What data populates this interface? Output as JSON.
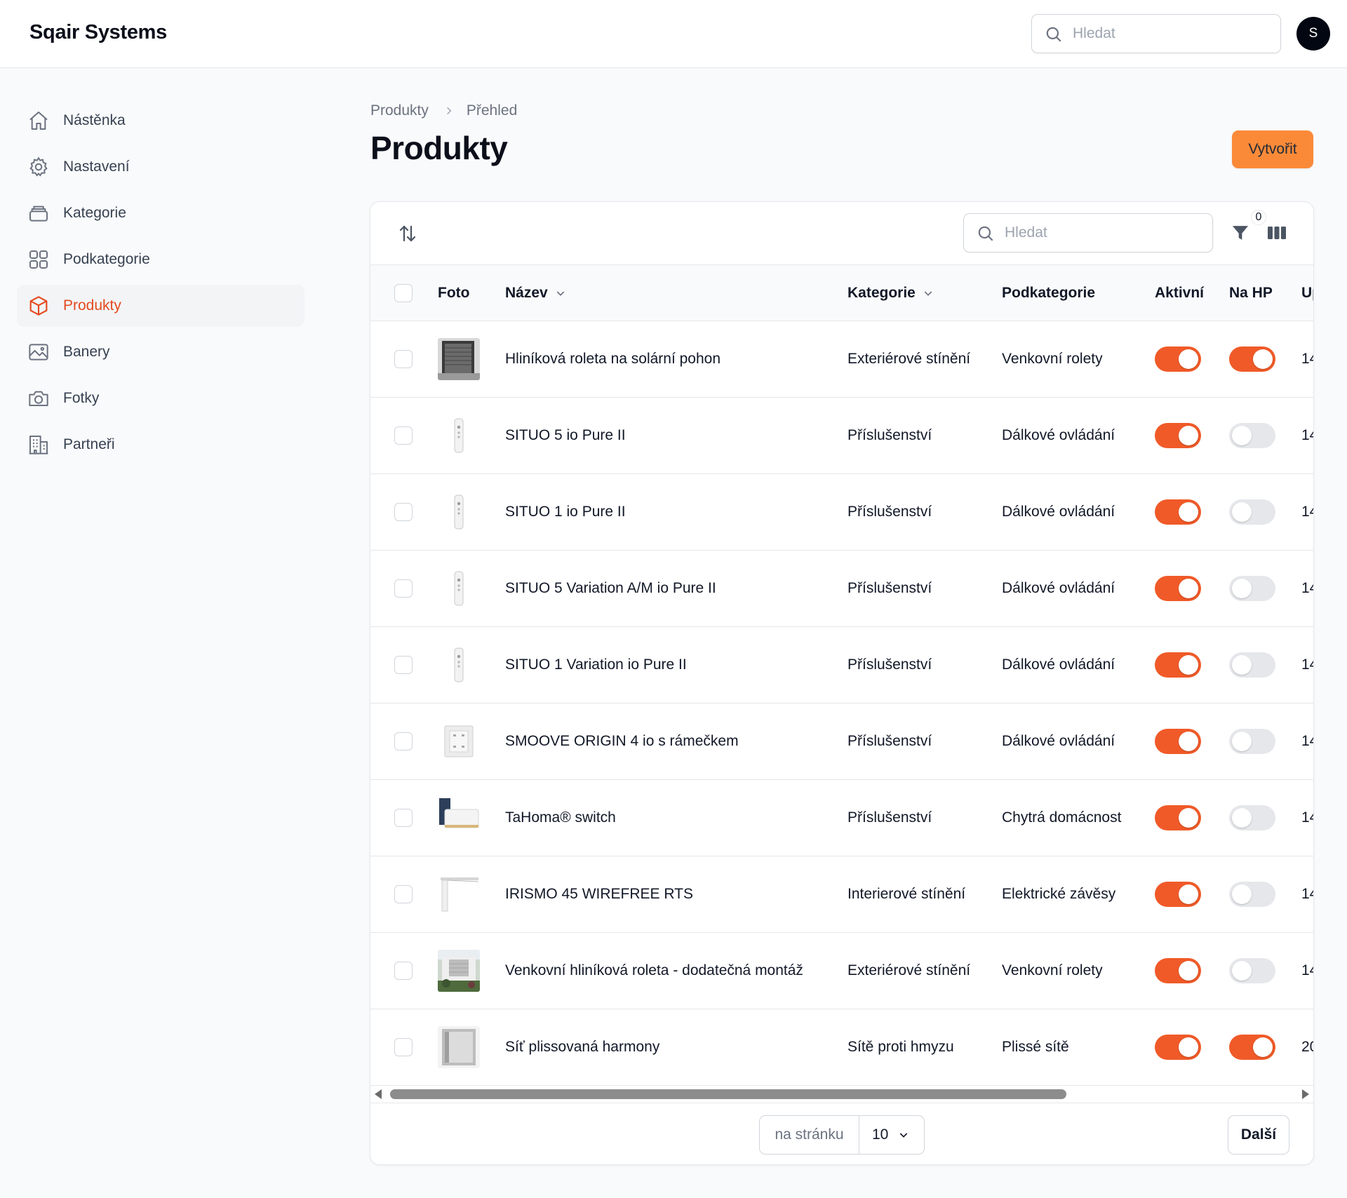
{
  "app": {
    "brand": "Sqair Systems",
    "avatar_initial": "S"
  },
  "header": {
    "search_placeholder": "Hledat"
  },
  "sidebar": {
    "items": [
      {
        "label": "Nástěnka",
        "icon": "home-icon",
        "active": false
      },
      {
        "label": "Nastavení",
        "icon": "gear-icon",
        "active": false
      },
      {
        "label": "Kategorie",
        "icon": "stack-icon",
        "active": false
      },
      {
        "label": "Podkategorie",
        "icon": "grid-icon",
        "active": false
      },
      {
        "label": "Produkty",
        "icon": "cube-icon",
        "active": true
      },
      {
        "label": "Banery",
        "icon": "image-icon",
        "active": false
      },
      {
        "label": "Fotky",
        "icon": "camera-icon",
        "active": false
      },
      {
        "label": "Partneři",
        "icon": "building-icon",
        "active": false
      }
    ]
  },
  "breadcrumb": {
    "root": "Produkty",
    "current": "Přehled"
  },
  "page": {
    "title": "Produkty",
    "create_label": "Vytvořit"
  },
  "table": {
    "search_placeholder": "Hledat",
    "filter_count": "0",
    "columns": {
      "photo": "Foto",
      "name": "Název",
      "category": "Kategorie",
      "subcategory": "Podkategorie",
      "active": "Aktivní",
      "on_hp": "Na HP",
      "updated": "Up"
    },
    "rows": [
      {
        "thumb": "roller-shutter-photo",
        "name": "Hliníková roleta na solární pohon",
        "category": "Exteriérové stínění",
        "subcategory": "Venkovní rolety",
        "active": true,
        "on_hp": true,
        "updated": "14"
      },
      {
        "thumb": "remote-control-photo",
        "name": "SITUO 5 io Pure II",
        "category": "Příslušenství",
        "subcategory": "Dálkové ovládání",
        "active": true,
        "on_hp": false,
        "updated": "14"
      },
      {
        "thumb": "remote-control-photo",
        "name": "SITUO 1 io Pure II",
        "category": "Příslušenství",
        "subcategory": "Dálkové ovládání",
        "active": true,
        "on_hp": false,
        "updated": "14"
      },
      {
        "thumb": "remote-control-photo",
        "name": "SITUO 5 Variation A/M io Pure II",
        "category": "Příslušenství",
        "subcategory": "Dálkové ovládání",
        "active": true,
        "on_hp": false,
        "updated": "14"
      },
      {
        "thumb": "remote-control-photo",
        "name": "SITUO 1 Variation io Pure II",
        "category": "Příslušenství",
        "subcategory": "Dálkové ovládání",
        "active": true,
        "on_hp": false,
        "updated": "14"
      },
      {
        "thumb": "wall-switch-photo",
        "name": "SMOOVE ORIGIN 4 io s rámečkem",
        "category": "Příslušenství",
        "subcategory": "Dálkové ovládání",
        "active": true,
        "on_hp": false,
        "updated": "14"
      },
      {
        "thumb": "smart-hub-photo",
        "name": "TaHoma® switch",
        "category": "Příslušenství",
        "subcategory": "Chytrá domácnost",
        "active": true,
        "on_hp": false,
        "updated": "14"
      },
      {
        "thumb": "curtain-rail-photo",
        "name": "IRISMO 45 WIREFREE RTS",
        "category": "Interierové stínění",
        "subcategory": "Elektrické závěsy",
        "active": true,
        "on_hp": false,
        "updated": "14"
      },
      {
        "thumb": "house-facade-photo",
        "name": "Venkovní hliníková roleta - dodatečná montáž",
        "category": "Exteriérové stínění",
        "subcategory": "Venkovní rolety",
        "active": true,
        "on_hp": false,
        "updated": "14"
      },
      {
        "thumb": "insect-screen-photo",
        "name": "Síť plissovaná harmony",
        "category": "Sítě proti hmyzu",
        "subcategory": "Plissé sítě",
        "active": true,
        "on_hp": true,
        "updated": "20"
      }
    ]
  },
  "pagination": {
    "per_page_label": "na stránku",
    "per_page_value": "10",
    "next_label": "Další"
  },
  "colors": {
    "accent": "#f05a28",
    "create_button": "#fb8a38",
    "active_nav_text": "#e34a1e"
  }
}
